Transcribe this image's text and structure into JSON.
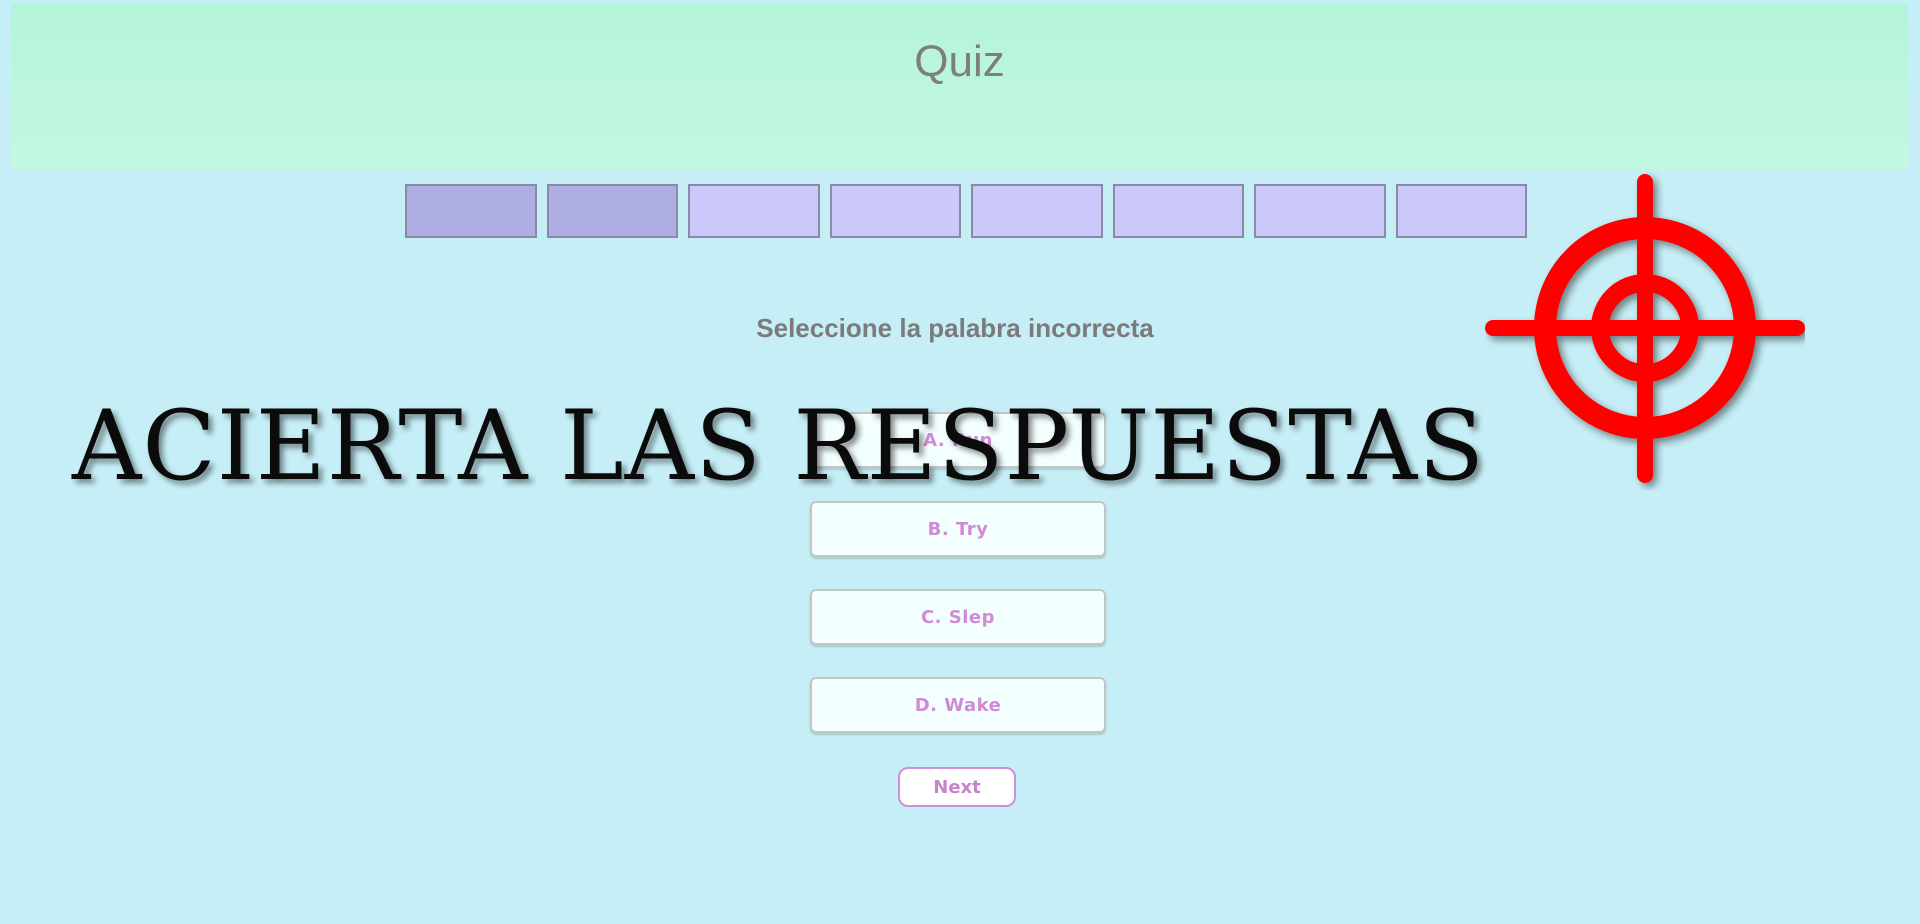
{
  "header": {
    "title": "Quiz"
  },
  "progress": {
    "completed": 2,
    "total": 8
  },
  "question": {
    "text": "Seleccione la palabra incorrecta"
  },
  "answers": [
    {
      "label": "A. Run"
    },
    {
      "label": "B. Try"
    },
    {
      "label": "C. Slep"
    },
    {
      "label": "D. Wake"
    }
  ],
  "next_button": {
    "label": "Next"
  },
  "overlay": {
    "title": "ACIERTA LAS RESPUESTAS"
  },
  "colors": {
    "header_bg": "#b4f4d8",
    "page_bg": "#c6eef6",
    "step_done": "#afaee2",
    "step_pending": "#cbc8fa",
    "answer_text": "#d08ad6",
    "target_red": "#ff0000"
  },
  "icons": {
    "target": "crosshair-target-icon"
  }
}
